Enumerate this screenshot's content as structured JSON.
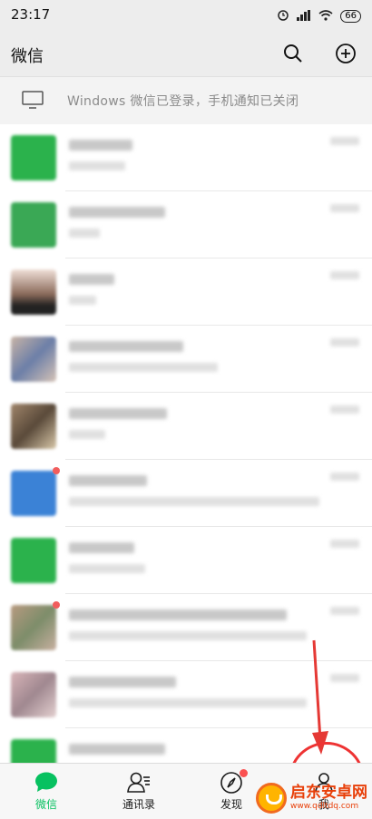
{
  "status_bar": {
    "time": "23:17",
    "battery": "66"
  },
  "header": {
    "title": "微信"
  },
  "notice": {
    "text": "Windows 微信已登录，手机通知已关闭"
  },
  "tabbar": {
    "tabs": [
      {
        "label": "微信",
        "active": true
      },
      {
        "label": "通讯录",
        "active": false
      },
      {
        "label": "发现",
        "active": false,
        "badge": true
      },
      {
        "label": "我",
        "active": false
      }
    ]
  },
  "watermark": {
    "brand": "启东安卓网",
    "url": "www.qdltdq.com"
  },
  "colors": {
    "accent": "#07c160",
    "badge": "#fa5151",
    "annotation": "#e53935"
  }
}
